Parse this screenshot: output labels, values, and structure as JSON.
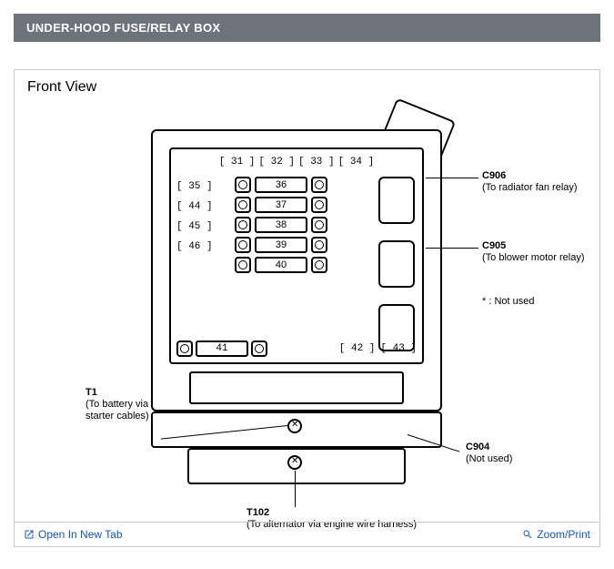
{
  "header": {
    "title": "UNDER-HOOD FUSE/RELAY BOX"
  },
  "diagram": {
    "title": "Front View",
    "top_row": [
      "31",
      "32",
      "33",
      "34"
    ],
    "top_row_star_index": 3,
    "left_column": [
      "35",
      "44",
      "45",
      "46"
    ],
    "left_column_star_indexes": [
      1,
      2,
      3
    ],
    "fuses_center": [
      "36",
      "37",
      "38",
      "39",
      "40"
    ],
    "bottom_fuse": "41",
    "bottom_brackets": [
      "42",
      "43"
    ],
    "relays": [
      "C906",
      "C905",
      "C904"
    ],
    "callouts": {
      "c906": {
        "id": "C906",
        "desc": "(To radiator fan relay)"
      },
      "c905": {
        "id": "C905",
        "desc": "(To blower motor relay)"
      },
      "c904": {
        "id": "C904",
        "desc": "(Not used)"
      },
      "t1": {
        "id": "T1",
        "desc": "(To battery via\nstarter cables)"
      },
      "t102": {
        "id": "T102",
        "desc": "(To alternator via engine wire harness)"
      }
    },
    "note": "* : Not used"
  },
  "footer": {
    "open_label": "Open In New Tab",
    "zoom_label": "Zoom/Print"
  }
}
